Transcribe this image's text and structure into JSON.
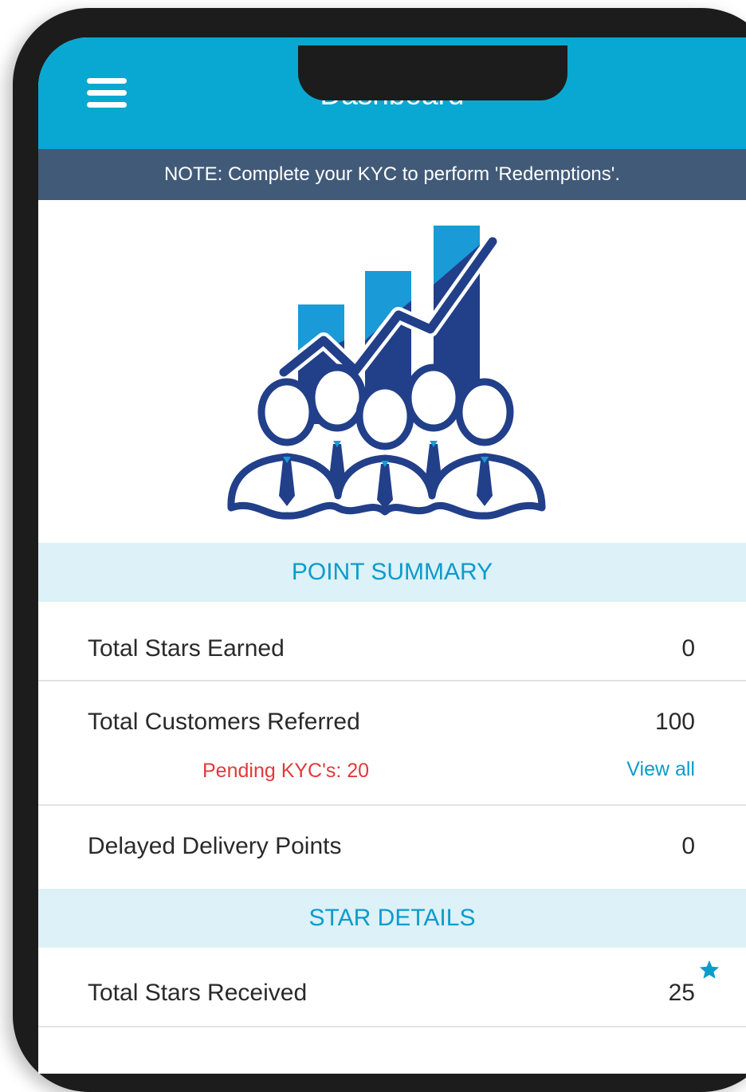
{
  "header": {
    "title": "Dashboard",
    "menu_icon": "hamburger-menu-icon"
  },
  "notice": {
    "text": "NOTE:  Complete your KYC to perform 'Redemptions'."
  },
  "illustration": {
    "icon": "business-growth-team-icon"
  },
  "point_summary": {
    "title": "POINT SUMMARY",
    "rows": [
      {
        "label": "Total Stars Earned",
        "value": "0"
      },
      {
        "label": "Total Customers Referred",
        "value": "100"
      },
      {
        "label": "Delayed Delivery Points",
        "value": "0"
      }
    ],
    "pending_kyc": "Pending KYC's:  20",
    "view_all": "View all"
  },
  "star_details": {
    "title": "STAR DETAILS",
    "rows": [
      {
        "label": "Total Stars Received",
        "value": "25",
        "icon": "star-icon"
      }
    ]
  },
  "colors": {
    "header_bg": "#08a8d2",
    "note_bg": "#415a78",
    "section_bg": "#dcf1f8",
    "accent": "#0c9ccb",
    "pending": "#e03a3a"
  }
}
